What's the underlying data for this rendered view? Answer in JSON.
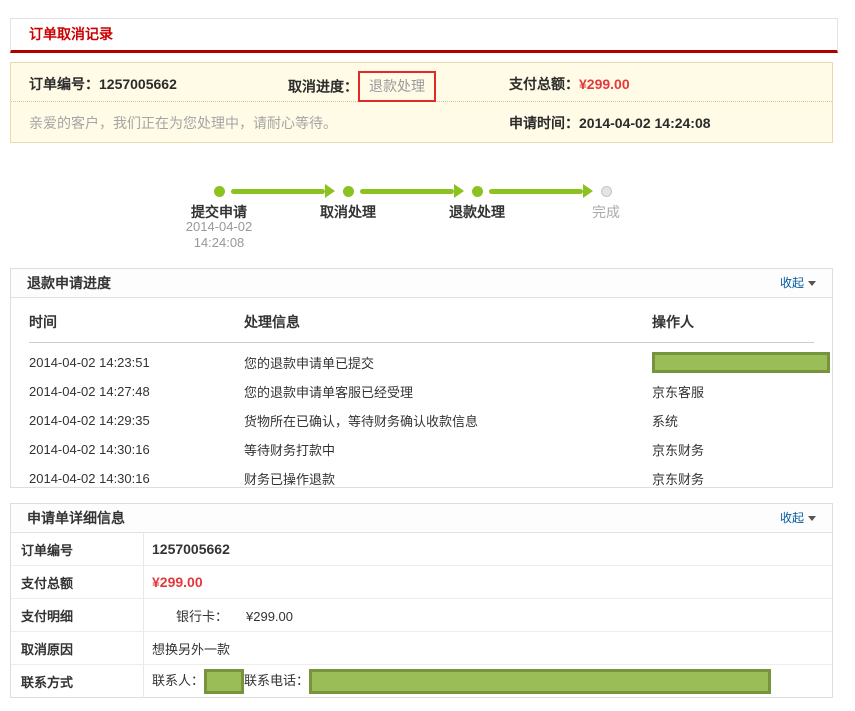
{
  "page": {
    "title": "订单取消记录"
  },
  "summary": {
    "order_label": "订单编号：",
    "order_number": "1257005662",
    "progress_label": "取消进度：",
    "progress_value": "退款处理",
    "total_label": "支付总额：",
    "total_value": "¥299.00",
    "notice": "亲爱的客户，我们正在为您处理中，请耐心等待。",
    "apply_time_label": "申请时间：",
    "apply_time": "2014-04-02 14:24:08"
  },
  "timeline": {
    "steps": [
      {
        "label": "提交申请",
        "date": "2014-04-02",
        "time": "14:24:08",
        "state": "done"
      },
      {
        "label": "取消处理",
        "state": "done"
      },
      {
        "label": "退款处理",
        "state": "done"
      },
      {
        "label": "完成",
        "state": "pending"
      }
    ]
  },
  "progress": {
    "title": "退款申请进度",
    "collapse_label": "收起",
    "headers": [
      "时间",
      "处理信息",
      "操作人"
    ],
    "rows": [
      {
        "time": "2014-04-02 14:23:51",
        "info": "您的退款申请单已提交",
        "operator": "",
        "operator_redacted": true
      },
      {
        "time": "2014-04-02 14:27:48",
        "info": "您的退款申请单客服已经受理",
        "operator": "京东客服"
      },
      {
        "time": "2014-04-02 14:29:35",
        "info": "货物所在已确认，等待财务确认收款信息",
        "operator": "系统"
      },
      {
        "time": "2014-04-02 14:30:16",
        "info": "等待财务打款中",
        "operator": "京东财务"
      },
      {
        "time": "2014-04-02 14:30:16",
        "info": "财务已操作退款",
        "operator": "京东财务"
      }
    ]
  },
  "details": {
    "title": "申请单详细信息",
    "collapse_label": "收起",
    "order_label": "订单编号",
    "order_value": "1257005662",
    "total_label": "支付总额",
    "total_value": "¥299.00",
    "breakdown_label": "支付明细",
    "breakdown_method": "银行卡：",
    "breakdown_amount": "¥299.00",
    "reason_label": "取消原因",
    "reason_value": "想换另外一款",
    "contact_label": "联系方式",
    "contact_person_label": "联系人：",
    "contact_phone_label": "联系电话："
  },
  "colors": {
    "title_red": "#cc0000",
    "title_rule_red": "#b10000",
    "price_red": "#e4393c",
    "highlight_border_red": "#e02a2a",
    "link_blue": "#005aa0",
    "timeline_green": "#8bc220",
    "redaction_fill_green": "#9bbd58",
    "redaction_border_green": "#75943c",
    "summary_bg": "#fffbe6",
    "summary_border": "#ead9b0"
  }
}
